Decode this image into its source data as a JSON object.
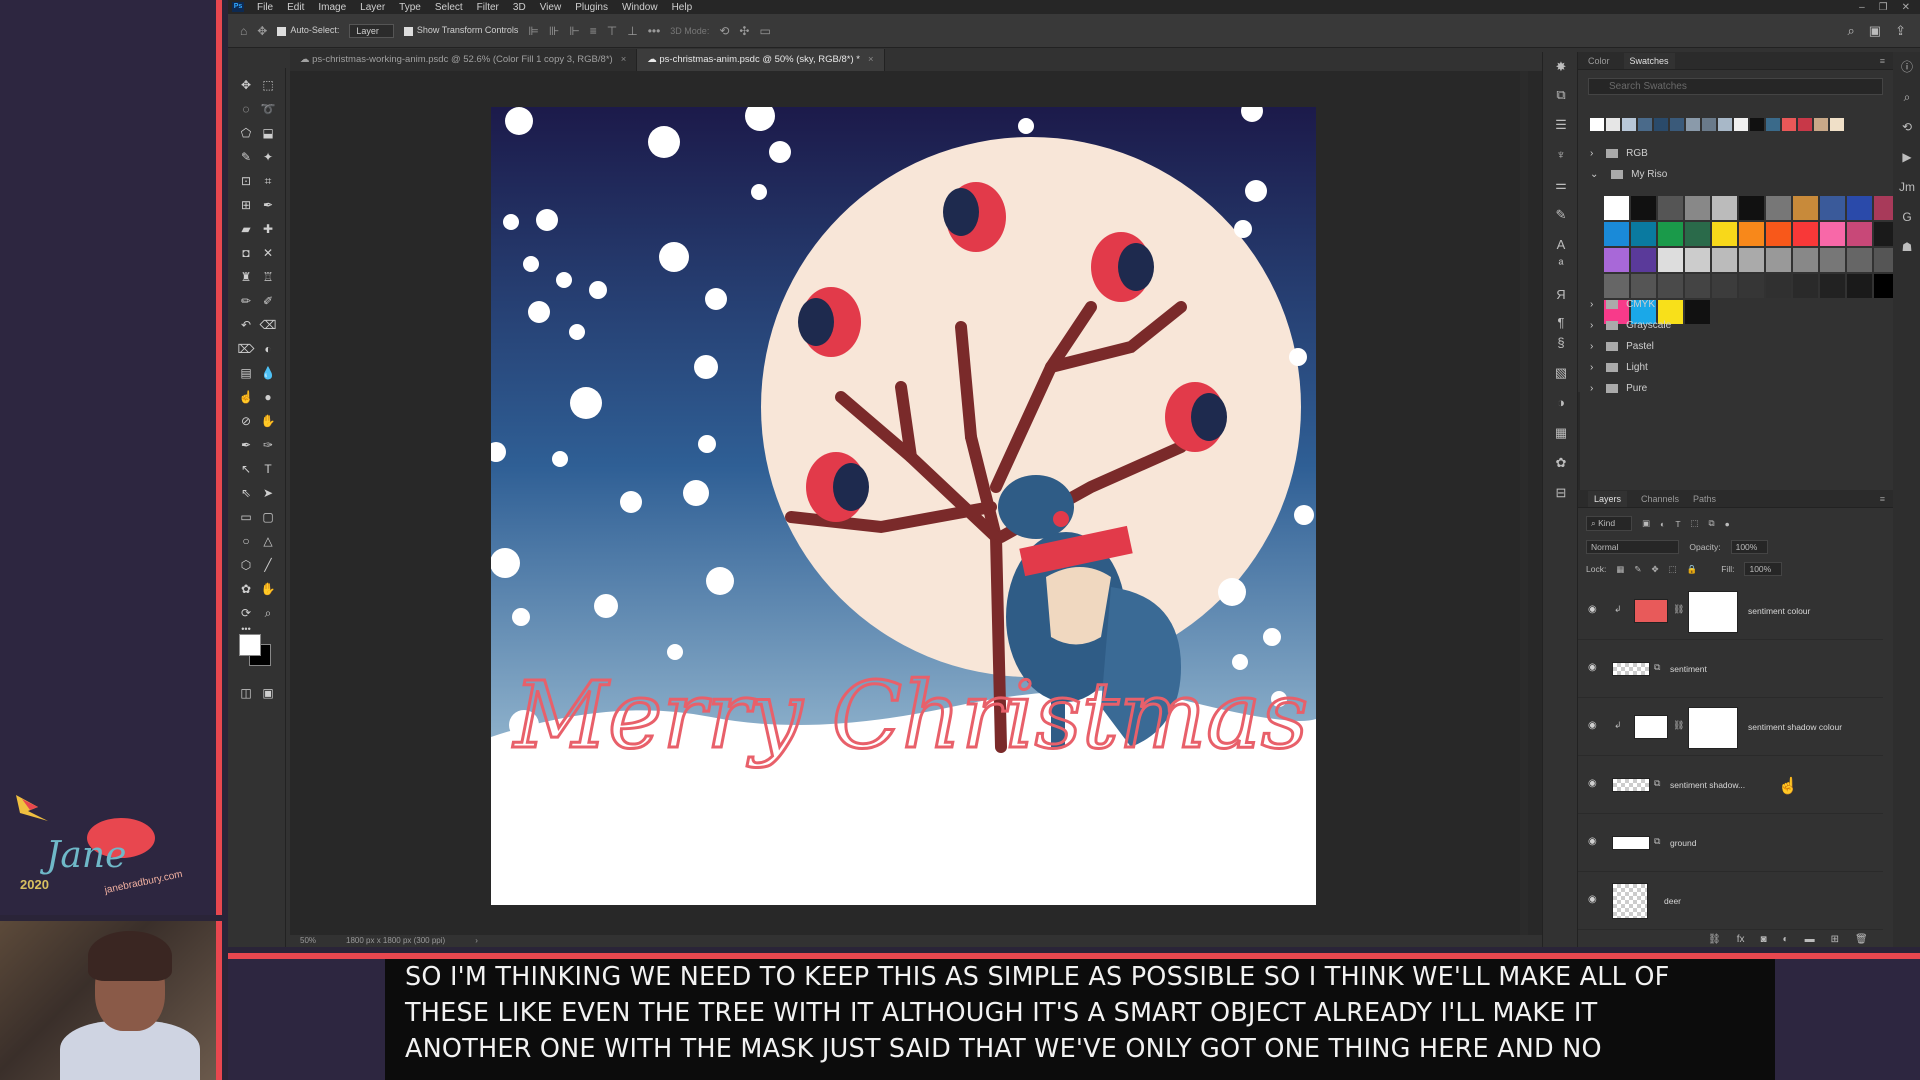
{
  "app": {
    "menu": [
      "File",
      "Edit",
      "Image",
      "Layer",
      "Type",
      "Select",
      "Filter",
      "3D",
      "View",
      "Plugins",
      "Window",
      "Help"
    ],
    "logo_text": "Ps"
  },
  "options_bar": {
    "auto_select_label": "Auto-Select:",
    "auto_select_value": "Layer",
    "show_transform_label": "Show Transform Controls",
    "mode_3d": "3D Mode:"
  },
  "tabs": [
    {
      "label": "ps-christmas-working-anim.psdc @ 52.6% (Color Fill 1 copy 3, RGB/8*)"
    },
    {
      "label": "ps-christmas-anim.psdc @ 50% (sky, RGB/8*) *"
    }
  ],
  "artwork": {
    "greeting": "Merry Christmas"
  },
  "status_bar": {
    "zoom": "50%",
    "doc_info": "1800 px x 1800 px (300 ppi)"
  },
  "swatches_panel": {
    "tabs": [
      "Color",
      "Swatches"
    ],
    "search_placeholder": "Search Swatches",
    "recent_colors": [
      "#ffffff",
      "#e6e6e6",
      "#b8c7d8",
      "#4a6a8a",
      "#2a4a6a",
      "#3a5a7a",
      "#8a9aaa",
      "#6a7a8a",
      "#a8b8c8",
      "#f0f0f0",
      "#111111",
      "#3a6a8a",
      "#e85858",
      "#c83848",
      "#c8a888",
      "#f0e0c8"
    ],
    "groups": [
      "RGB",
      "My Riso",
      "CMYK",
      "Grayscale",
      "Pastel",
      "Light",
      "Pure"
    ],
    "riso_colors": [
      "#ffffff",
      "#111111",
      "#555555",
      "#888888",
      "#bbbbbb",
      "#111111",
      "#777777",
      "#c88a3a",
      "#3a5a9a",
      "#2a4aaa",
      "#a83a5a",
      "#1a8ad8",
      "#0a7aa0",
      "#1a9a4a",
      "#2a6a4a",
      "#f8d81a",
      "#f8881a",
      "#f8581a",
      "#f83838",
      "#f868a8",
      "#c84878",
      "#1a1a1a",
      "#a868d8",
      "#5a3a9a",
      "#dddddd",
      "#cccccc",
      "#bbbbbb",
      "#aaaaaa",
      "#999999",
      "#888888",
      "#777777",
      "#666666",
      "#555555",
      "#666666",
      "#555555",
      "#4a4a4a",
      "#444444",
      "#3c3c3c",
      "#363636",
      "#303030",
      "#2a2a2a",
      "#222222",
      "#1a1a1a",
      "#000000",
      "#f83a8a",
      "#1aa8e8",
      "#f8e01a",
      "#111111"
    ]
  },
  "layers_panel": {
    "tabs": [
      "Layers",
      "Channels",
      "Paths"
    ],
    "filter_kind": "Kind",
    "blend_mode": "Normal",
    "opacity_label": "Opacity:",
    "opacity_value": "100%",
    "lock_label": "Lock:",
    "fill_label": "Fill:",
    "fill_value": "100%",
    "layers": [
      {
        "name": "sentiment colour",
        "thumb": "#e85a5a"
      },
      {
        "name": "sentiment"
      },
      {
        "name": "sentiment shadow colour",
        "thumb": "#ffffff"
      },
      {
        "name": "sentiment shadow..."
      },
      {
        "name": "ground"
      },
      {
        "name": "deer"
      }
    ]
  },
  "overlay": {
    "brand": "Jane",
    "year": "2020",
    "site": "janebradbury.com",
    "caption": [
      "SO I'M THINKING WE NEED TO KEEP THIS AS SIMPLE AS POSSIBLE SO I THINK WE'LL MAKE ALL OF",
      "THESE LIKE EVEN THE TREE WITH IT ALTHOUGH IT'S A SMART OBJECT ALREADY I'LL MAKE IT",
      "ANOTHER ONE WITH THE MASK JUST SAID THAT WE'VE ONLY GOT ONE THING HERE AND NO"
    ]
  }
}
